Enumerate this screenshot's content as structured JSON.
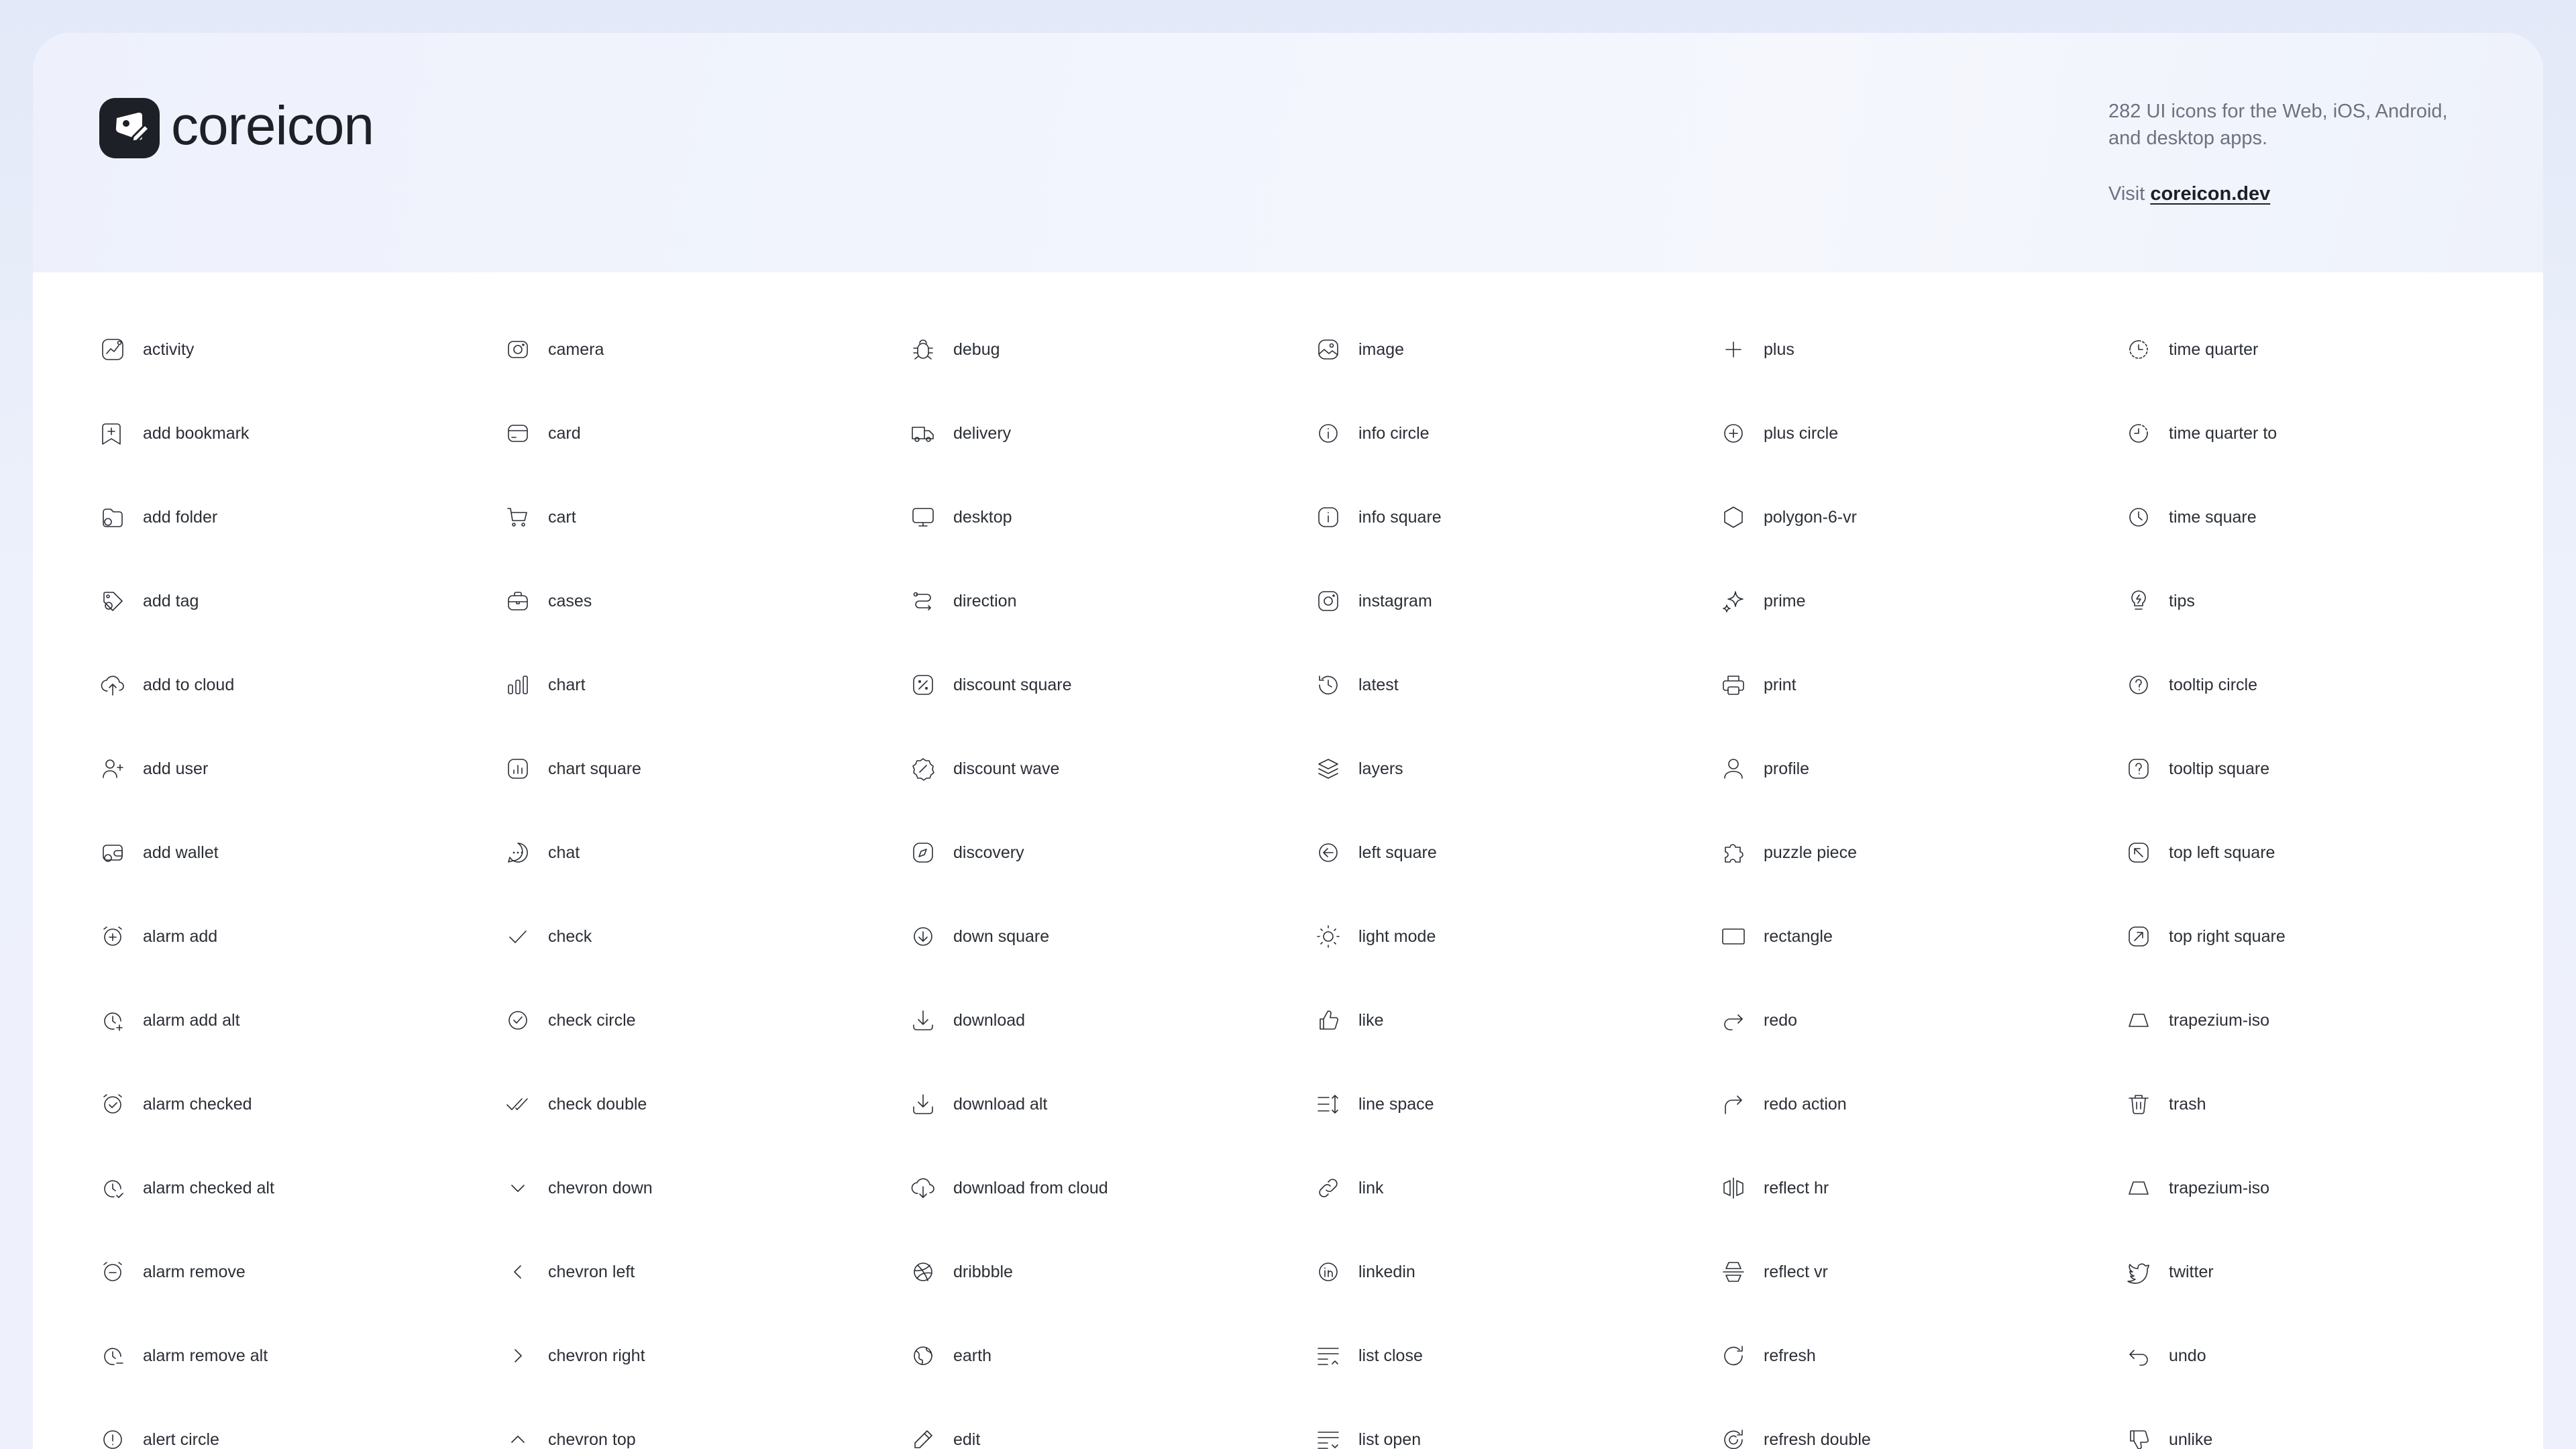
{
  "brand": {
    "name": "coreicon",
    "description": "282 UI icons for the Web, iOS, Android, and desktop apps.",
    "visit_prefix": "Visit",
    "visit_link": "coreicon.dev"
  },
  "colors": {
    "background": "#e3e9f8",
    "card": "#ffffff",
    "text": "#2b2f36",
    "muted": "#6d7280",
    "logo": "#1d2026"
  },
  "columns": [
    [
      {
        "label": "activity",
        "icon": "activity-icon"
      },
      {
        "label": "add bookmark",
        "icon": "add-bookmark-icon"
      },
      {
        "label": "add folder",
        "icon": "add-folder-icon"
      },
      {
        "label": "add tag",
        "icon": "add-tag-icon"
      },
      {
        "label": "add to cloud",
        "icon": "add-to-cloud-icon"
      },
      {
        "label": "add user",
        "icon": "add-user-icon"
      },
      {
        "label": "add wallet",
        "icon": "add-wallet-icon"
      },
      {
        "label": "alarm add",
        "icon": "alarm-add-icon"
      },
      {
        "label": "alarm add alt",
        "icon": "alarm-add-alt-icon"
      },
      {
        "label": "alarm checked",
        "icon": "alarm-checked-icon"
      },
      {
        "label": "alarm checked alt",
        "icon": "alarm-checked-alt-icon"
      },
      {
        "label": "alarm remove",
        "icon": "alarm-remove-icon"
      },
      {
        "label": "alarm remove alt",
        "icon": "alarm-remove-alt-icon"
      },
      {
        "label": "alert circle",
        "icon": "alert-circle-icon"
      }
    ],
    [
      {
        "label": "camera",
        "icon": "camera-icon"
      },
      {
        "label": "card",
        "icon": "card-icon"
      },
      {
        "label": "cart",
        "icon": "cart-icon"
      },
      {
        "label": "cases",
        "icon": "cases-icon"
      },
      {
        "label": "chart",
        "icon": "chart-icon"
      },
      {
        "label": "chart square",
        "icon": "chart-square-icon"
      },
      {
        "label": "chat",
        "icon": "chat-icon"
      },
      {
        "label": "check",
        "icon": "check-icon"
      },
      {
        "label": "check circle",
        "icon": "check-circle-icon"
      },
      {
        "label": "check double",
        "icon": "check-double-icon"
      },
      {
        "label": "chevron down",
        "icon": "chevron-down-icon"
      },
      {
        "label": "chevron left",
        "icon": "chevron-left-icon"
      },
      {
        "label": "chevron right",
        "icon": "chevron-right-icon"
      },
      {
        "label": "chevron top",
        "icon": "chevron-top-icon"
      }
    ],
    [
      {
        "label": "debug",
        "icon": "debug-icon"
      },
      {
        "label": "delivery",
        "icon": "delivery-icon"
      },
      {
        "label": "desktop",
        "icon": "desktop-icon"
      },
      {
        "label": "direction",
        "icon": "direction-icon"
      },
      {
        "label": "discount square",
        "icon": "discount-square-icon"
      },
      {
        "label": "discount wave",
        "icon": "discount-wave-icon"
      },
      {
        "label": "discovery",
        "icon": "discovery-icon"
      },
      {
        "label": "down square",
        "icon": "down-square-icon"
      },
      {
        "label": "download",
        "icon": "download-icon"
      },
      {
        "label": "download alt",
        "icon": "download-alt-icon"
      },
      {
        "label": "download from cloud",
        "icon": "download-from-cloud-icon"
      },
      {
        "label": "dribbble",
        "icon": "dribbble-icon"
      },
      {
        "label": "earth",
        "icon": "earth-icon"
      },
      {
        "label": "edit",
        "icon": "edit-icon"
      }
    ],
    [
      {
        "label": "image",
        "icon": "image-icon"
      },
      {
        "label": "info circle",
        "icon": "info-circle-icon"
      },
      {
        "label": "info square",
        "icon": "info-square-icon"
      },
      {
        "label": "instagram",
        "icon": "instagram-icon"
      },
      {
        "label": "latest",
        "icon": "latest-icon"
      },
      {
        "label": "layers",
        "icon": "layers-icon"
      },
      {
        "label": "left square",
        "icon": "left-square-icon"
      },
      {
        "label": "light mode",
        "icon": "light-mode-icon"
      },
      {
        "label": "like",
        "icon": "like-icon"
      },
      {
        "label": "line space",
        "icon": "line-space-icon"
      },
      {
        "label": "link",
        "icon": "link-icon"
      },
      {
        "label": "linkedin",
        "icon": "linkedin-icon"
      },
      {
        "label": "list close",
        "icon": "list-close-icon"
      },
      {
        "label": "list open",
        "icon": "list-open-icon"
      }
    ],
    [
      {
        "label": "plus",
        "icon": "plus-icon"
      },
      {
        "label": "plus circle",
        "icon": "plus-circle-icon"
      },
      {
        "label": "polygon-6-vr",
        "icon": "polygon-6-vr-icon"
      },
      {
        "label": "prime",
        "icon": "prime-icon"
      },
      {
        "label": "print",
        "icon": "print-icon"
      },
      {
        "label": "profile",
        "icon": "profile-icon"
      },
      {
        "label": "puzzle piece",
        "icon": "puzzle-piece-icon"
      },
      {
        "label": "rectangle",
        "icon": "rectangle-icon"
      },
      {
        "label": "redo",
        "icon": "redo-icon"
      },
      {
        "label": "redo action",
        "icon": "redo-action-icon"
      },
      {
        "label": "reflect hr",
        "icon": "reflect-hr-icon"
      },
      {
        "label": "reflect vr",
        "icon": "reflect-vr-icon"
      },
      {
        "label": "refresh",
        "icon": "refresh-icon"
      },
      {
        "label": "refresh double",
        "icon": "refresh-double-icon"
      }
    ],
    [
      {
        "label": "time quarter",
        "icon": "time-quarter-icon"
      },
      {
        "label": "time quarter to",
        "icon": "time-quarter-to-icon"
      },
      {
        "label": "time square",
        "icon": "time-square-icon"
      },
      {
        "label": "tips",
        "icon": "tips-icon"
      },
      {
        "label": "tooltip circle",
        "icon": "tooltip-circle-icon"
      },
      {
        "label": "tooltip square",
        "icon": "tooltip-square-icon"
      },
      {
        "label": "top left square",
        "icon": "top-left-square-icon"
      },
      {
        "label": "top right square",
        "icon": "top-right-square-icon"
      },
      {
        "label": "trapezium-iso",
        "icon": "trapezium-iso-icon"
      },
      {
        "label": "trash",
        "icon": "trash-icon"
      },
      {
        "label": "trapezium-iso",
        "icon": "trapezium-iso-icon"
      },
      {
        "label": "twitter",
        "icon": "twitter-icon"
      },
      {
        "label": "undo",
        "icon": "undo-icon"
      },
      {
        "label": "unlike",
        "icon": "unlike-icon"
      }
    ]
  ]
}
